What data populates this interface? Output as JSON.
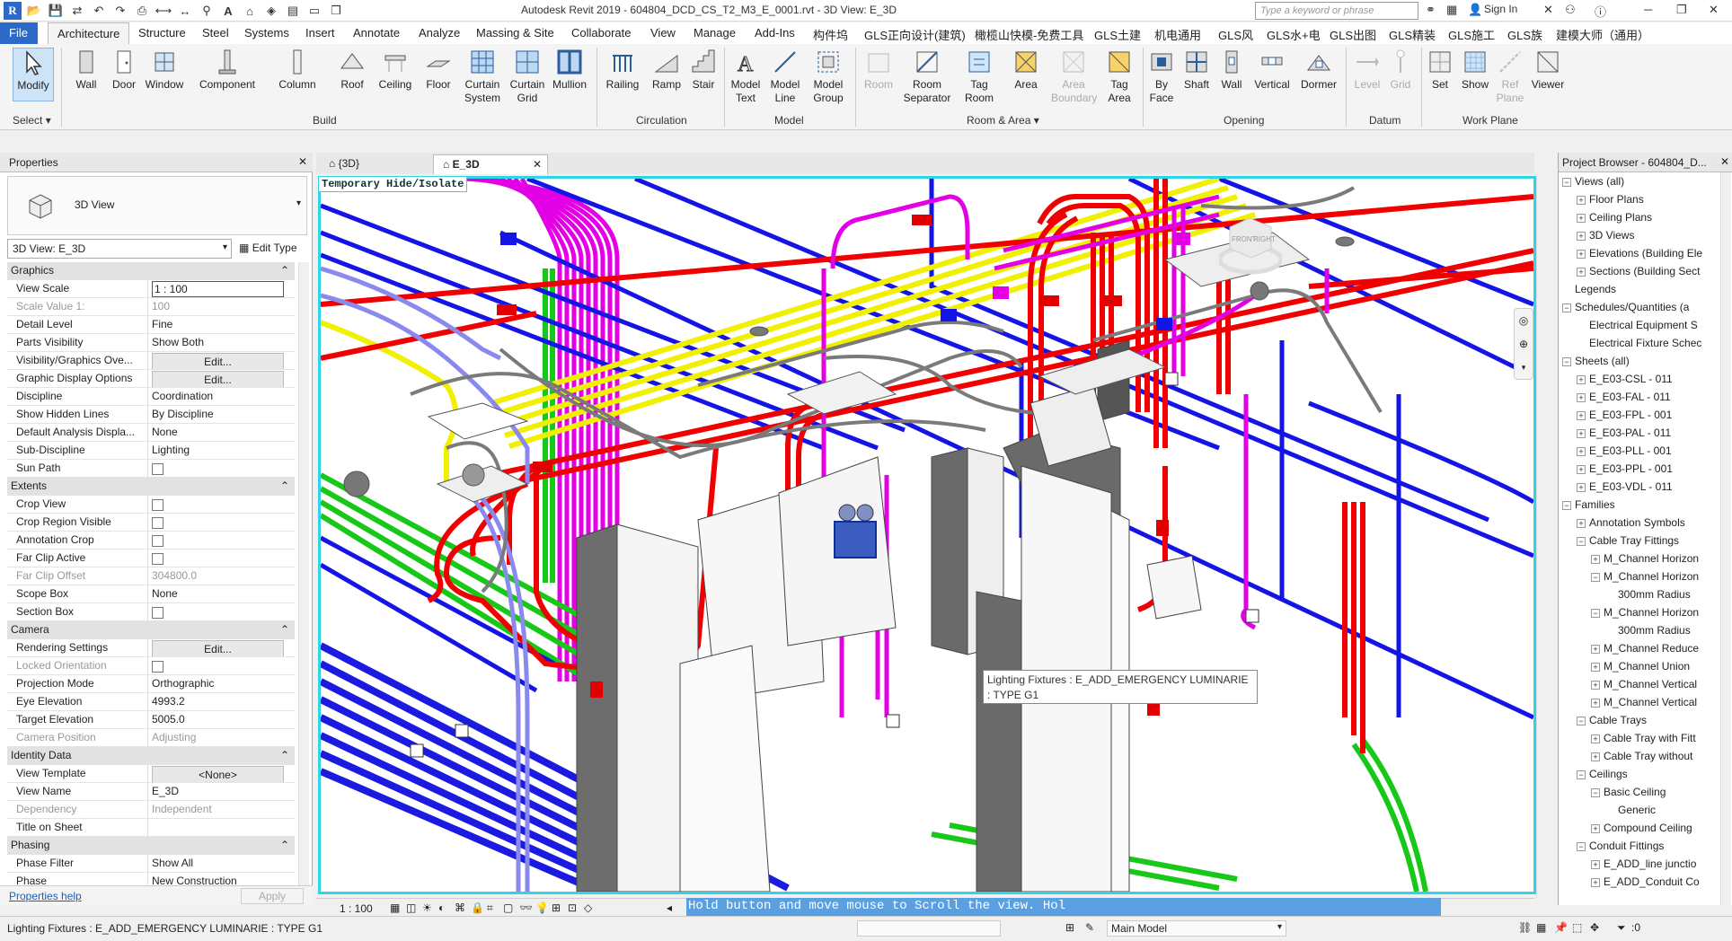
{
  "window": {
    "title": "Autodesk Revit 2019 - 604804_DCD_CS_T2_M3_E_0001.rvt - 3D View: E_3D",
    "search_placeholder": "Type a keyword or phrase",
    "sign_in": "Sign In"
  },
  "menu": {
    "tabs": [
      "File",
      "Architecture",
      "Structure",
      "Steel",
      "Systems",
      "Insert",
      "Annotate",
      "Analyze",
      "Massing & Site",
      "Collaborate",
      "View",
      "Manage",
      "Add-Ins",
      "构件坞",
      "GLS正向设计(建筑)",
      "橄榄山快模-免费工具",
      "GLS土建",
      "机电通用",
      "GLS风",
      "GLS水+电",
      "GLS出图",
      "GLS精装",
      "GLS施工",
      "GLS族",
      "建模大师（通用）"
    ],
    "active": "Architecture"
  },
  "ribbon": {
    "modify": "Modify",
    "select": "Select",
    "build": [
      "Wall",
      "Door",
      "Window",
      "Component",
      "Column",
      "Roof",
      "Ceiling",
      "Floor",
      "Curtain System",
      "Curtain Grid",
      "Mullion"
    ],
    "build_label": "Build",
    "circulation": [
      "Railing",
      "Ramp",
      "Stair"
    ],
    "circulation_label": "Circulation",
    "model": [
      "Model Text",
      "Model Line",
      "Model Group"
    ],
    "model_label": "Model",
    "room": [
      "Room",
      "Room Separator",
      "Tag Room",
      "Area",
      "Area Boundary",
      "Tag Area"
    ],
    "room_label": "Room & Area",
    "opening": [
      "By Face",
      "Shaft",
      "Wall",
      "Vertical",
      "Dormer"
    ],
    "opening_label": "Opening",
    "datum": [
      "Level",
      "Grid"
    ],
    "datum_label": "Datum",
    "workplane": [
      "Set",
      "Show",
      "Ref Plane",
      "Viewer"
    ],
    "workplane_label": "Work Plane"
  },
  "properties": {
    "title": "Properties",
    "type_name": "3D View",
    "selector": "3D View: E_3D",
    "edit_type": "Edit Type",
    "rows": [
      {
        "cat": "Graphics"
      },
      {
        "k": "View Scale",
        "v": "1 : 100",
        "field": true
      },
      {
        "k": "Scale Value    1:",
        "v": "100",
        "dim": true
      },
      {
        "k": "Detail Level",
        "v": "Fine"
      },
      {
        "k": "Parts Visibility",
        "v": "Show Both"
      },
      {
        "k": "Visibility/Graphics Ove...",
        "v": "Edit...",
        "btn": true
      },
      {
        "k": "Graphic Display Options",
        "v": "Edit...",
        "btn": true
      },
      {
        "k": "Discipline",
        "v": "Coordination"
      },
      {
        "k": "Show Hidden Lines",
        "v": "By Discipline"
      },
      {
        "k": "Default Analysis Displa...",
        "v": "None"
      },
      {
        "k": "Sub-Discipline",
        "v": "Lighting"
      },
      {
        "k": "Sun Path",
        "chk": true
      },
      {
        "cat": "Extents"
      },
      {
        "k": "Crop View",
        "chk": true
      },
      {
        "k": "Crop Region Visible",
        "chk": true
      },
      {
        "k": "Annotation Crop",
        "chk": true
      },
      {
        "k": "Far Clip Active",
        "chk": true
      },
      {
        "k": "Far Clip Offset",
        "v": "304800.0",
        "dim": true
      },
      {
        "k": "Scope Box",
        "v": "None"
      },
      {
        "k": "Section Box",
        "chk": true
      },
      {
        "cat": "Camera"
      },
      {
        "k": "Rendering Settings",
        "v": "Edit...",
        "btn": true
      },
      {
        "k": "Locked Orientation",
        "chk": true,
        "dim": true
      },
      {
        "k": "Projection Mode",
        "v": "Orthographic"
      },
      {
        "k": "Eye Elevation",
        "v": "4993.2"
      },
      {
        "k": "Target Elevation",
        "v": "5005.0"
      },
      {
        "k": "Camera Position",
        "v": "Adjusting",
        "dim": true
      },
      {
        "cat": "Identity Data"
      },
      {
        "k": "View Template",
        "v": "<None>",
        "btn": true
      },
      {
        "k": "View Name",
        "v": "E_3D"
      },
      {
        "k": "Dependency",
        "v": "Independent",
        "dim": true
      },
      {
        "k": "Title on Sheet",
        "v": ""
      },
      {
        "cat": "Phasing"
      },
      {
        "k": "Phase Filter",
        "v": "Show All"
      },
      {
        "k": "Phase",
        "v": "New Construction"
      }
    ],
    "help": "Properties help",
    "apply": "Apply"
  },
  "viewtabs": [
    "{3D}",
    "E_3D"
  ],
  "view": {
    "temp_label": "Temporary Hide/Isolate",
    "tooltip_l1": "Lighting Fixtures : E_ADD_EMERGENCY LUMINARIE",
    "tooltip_l2": ": TYPE G1",
    "cube_top": "RIGHT",
    "cube_front": "FRONT"
  },
  "viewbar": {
    "scale": "1 : 100",
    "scroll_msg": "Hold button and move mouse to Scroll the view. Hol"
  },
  "status": {
    "text": "Lighting Fixtures : E_ADD_EMERGENCY LUMINARIE : TYPE G1",
    "model": "Main Model",
    "sel_count": ":0"
  },
  "browser": {
    "title": "Project Browser - 604804_D...",
    "nodes": [
      {
        "t": "Views (all)",
        "l": 0,
        "g": "−"
      },
      {
        "t": "Floor Plans",
        "l": 1,
        "g": "+"
      },
      {
        "t": "Ceiling Plans",
        "l": 1,
        "g": "+"
      },
      {
        "t": "3D Views",
        "l": 1,
        "g": "+"
      },
      {
        "t": "Elevations (Building Ele",
        "l": 1,
        "g": "+"
      },
      {
        "t": "Sections (Building Sect",
        "l": 1,
        "g": "+"
      },
      {
        "t": "Legends",
        "l": 0,
        "g": ""
      },
      {
        "t": "Schedules/Quantities (a",
        "l": 0,
        "g": "−"
      },
      {
        "t": "Electrical Equipment S",
        "l": 1,
        "g": ""
      },
      {
        "t": "Electrical Fixture Schec",
        "l": 1,
        "g": ""
      },
      {
        "t": "Sheets (all)",
        "l": 0,
        "g": "−"
      },
      {
        "t": "E_E03-CSL - 011",
        "l": 1,
        "g": "+"
      },
      {
        "t": "E_E03-FAL - 011",
        "l": 1,
        "g": "+"
      },
      {
        "t": "E_E03-FPL - 001",
        "l": 1,
        "g": "+"
      },
      {
        "t": "E_E03-PAL - 011",
        "l": 1,
        "g": "+"
      },
      {
        "t": "E_E03-PLL - 001",
        "l": 1,
        "g": "+"
      },
      {
        "t": "E_E03-PPL - 001",
        "l": 1,
        "g": "+"
      },
      {
        "t": "E_E03-VDL - 011",
        "l": 1,
        "g": "+"
      },
      {
        "t": "Families",
        "l": 0,
        "g": "−"
      },
      {
        "t": "Annotation Symbols",
        "l": 1,
        "g": "+"
      },
      {
        "t": "Cable Tray Fittings",
        "l": 1,
        "g": "−"
      },
      {
        "t": "M_Channel Horizon",
        "l": 2,
        "g": "+"
      },
      {
        "t": "M_Channel Horizon",
        "l": 2,
        "g": "−"
      },
      {
        "t": "300mm Radius",
        "l": 3,
        "g": ""
      },
      {
        "t": "M_Channel Horizon",
        "l": 2,
        "g": "−"
      },
      {
        "t": "300mm Radius",
        "l": 3,
        "g": ""
      },
      {
        "t": "M_Channel Reduce",
        "l": 2,
        "g": "+"
      },
      {
        "t": "M_Channel Union",
        "l": 2,
        "g": "+"
      },
      {
        "t": "M_Channel Vertical",
        "l": 2,
        "g": "+"
      },
      {
        "t": "M_Channel Vertical",
        "l": 2,
        "g": "+"
      },
      {
        "t": "Cable Trays",
        "l": 1,
        "g": "−"
      },
      {
        "t": "Cable Tray with Fitt",
        "l": 2,
        "g": "+"
      },
      {
        "t": "Cable Tray without",
        "l": 2,
        "g": "+"
      },
      {
        "t": "Ceilings",
        "l": 1,
        "g": "−"
      },
      {
        "t": "Basic Ceiling",
        "l": 2,
        "g": "−"
      },
      {
        "t": "Generic",
        "l": 3,
        "g": ""
      },
      {
        "t": "Compound Ceiling",
        "l": 2,
        "g": "+"
      },
      {
        "t": "Conduit Fittings",
        "l": 1,
        "g": "−"
      },
      {
        "t": "E_ADD_line junctio",
        "l": 2,
        "g": "+"
      },
      {
        "t": "E_ADD_Conduit Co",
        "l": 2,
        "g": "+"
      }
    ]
  }
}
